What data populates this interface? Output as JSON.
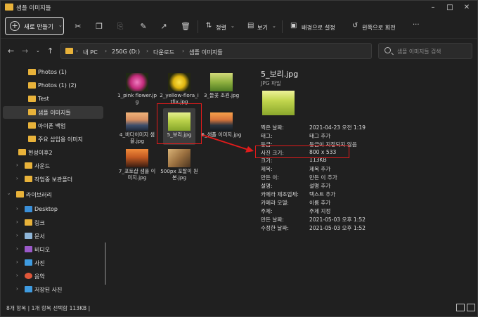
{
  "window": {
    "title": "샘플 이미지들"
  },
  "toolbar": {
    "new_label": "새로 만들기",
    "sort_label": "정렬",
    "view_label": "보기",
    "set_background_label": "배경으로 설정",
    "rotate_left_label": "왼쪽으로 회전",
    "more_label": "···"
  },
  "address": {
    "crumbs": [
      "내 PC",
      "250G (D:)",
      "다운로드",
      "샘플 이미지들"
    ],
    "search_placeholder": "샘플 이미지들 검색"
  },
  "sidebar": {
    "items": [
      {
        "label": "Photos (1)",
        "icon": "folder-icon"
      },
      {
        "label": "Photos (1) (2)",
        "icon": "folder-icon"
      },
      {
        "label": "Test",
        "icon": "folder-icon"
      },
      {
        "label": "샘플 이미지들",
        "icon": "folder-icon"
      },
      {
        "label": "아이폰 백업",
        "icon": "folder-icon"
      },
      {
        "label": "주요 삽입용 이미지",
        "icon": "folder-icon"
      },
      {
        "label": "현성이후2",
        "icon": "folder-icon"
      },
      {
        "label": "사운드",
        "icon": "folder-icon"
      },
      {
        "label": "작업중 보관폴더",
        "icon": "folder-icon"
      },
      {
        "label": "라이브러리",
        "icon": "library-icon"
      },
      {
        "label": "Desktop",
        "icon": "desktop-icon"
      },
      {
        "label": "링크",
        "icon": "link-icon"
      },
      {
        "label": "문서",
        "icon": "document-icon"
      },
      {
        "label": "비디오",
        "icon": "video-icon"
      },
      {
        "label": "사진",
        "icon": "picture-icon"
      },
      {
        "label": "음악",
        "icon": "music-icon"
      },
      {
        "label": "저장된 사진",
        "icon": "picture-icon"
      }
    ]
  },
  "files": [
    {
      "name": "1_pink flower.jpg",
      "colors": [
        "#b8246b",
        "#e37ab3"
      ]
    },
    {
      "name": "2_yellow-flora_itfix.jpg",
      "colors": [
        "#2b2f11",
        "#f4d21a"
      ]
    },
    {
      "name": "3_들꽃 조원.jpg",
      "colors": [
        "#5f8a2d",
        "#c9d46a"
      ]
    },
    {
      "name": "4_바다이미지 샘플.jpg",
      "colors": [
        "#e7a36b",
        "#4a5a7a"
      ]
    },
    {
      "name": "5_보리.jpg",
      "colors": [
        "#c5d84b",
        "#8aa32c"
      ]
    },
    {
      "name": "6_샘플 이미지.jpg",
      "colors": [
        "#e78a3c",
        "#27313a"
      ]
    },
    {
      "name": "7_포토샵 샘플 이미지.jpg",
      "colors": [
        "#d96e2a",
        "#3a1d12"
      ]
    },
    {
      "name": "500px 포탈이 원본.jpg",
      "colors": [
        "#c99d5a",
        "#5a4025"
      ]
    }
  ],
  "details": {
    "title": "5_보리.jpg",
    "type": "JPG 파일",
    "props": [
      {
        "k": "찍은 날짜:",
        "v": "2021-04-23 오전 1:19"
      },
      {
        "k": "태그:",
        "v": "태그 추가"
      },
      {
        "k": "등급:",
        "v": "등급이 지정되지 않음"
      },
      {
        "k": "사진 크기:",
        "v": "800 x 533"
      },
      {
        "k": "크기:",
        "v": "113KB"
      },
      {
        "k": "제목:",
        "v": "제목 추가"
      },
      {
        "k": "만든 이:",
        "v": "만든 이 추가"
      },
      {
        "k": "설명:",
        "v": "설명 추가"
      },
      {
        "k": "카메라 제조업체:",
        "v": "텍스트 추가"
      },
      {
        "k": "카메라 모델:",
        "v": "이름 추가"
      },
      {
        "k": "주제:",
        "v": "주제 지정"
      },
      {
        "k": "만든 날짜:",
        "v": "2021-05-03 오후 1:52"
      },
      {
        "k": "수정한 날짜:",
        "v": "2021-05-03 오후 1:52"
      }
    ]
  },
  "status": {
    "text": "8개 항목  |  1개 항목 선택함 113KB  |"
  },
  "colors": {
    "folder": "#e8b23a",
    "highlight": "#e21b1b",
    "selection": "#3d3d3d"
  }
}
